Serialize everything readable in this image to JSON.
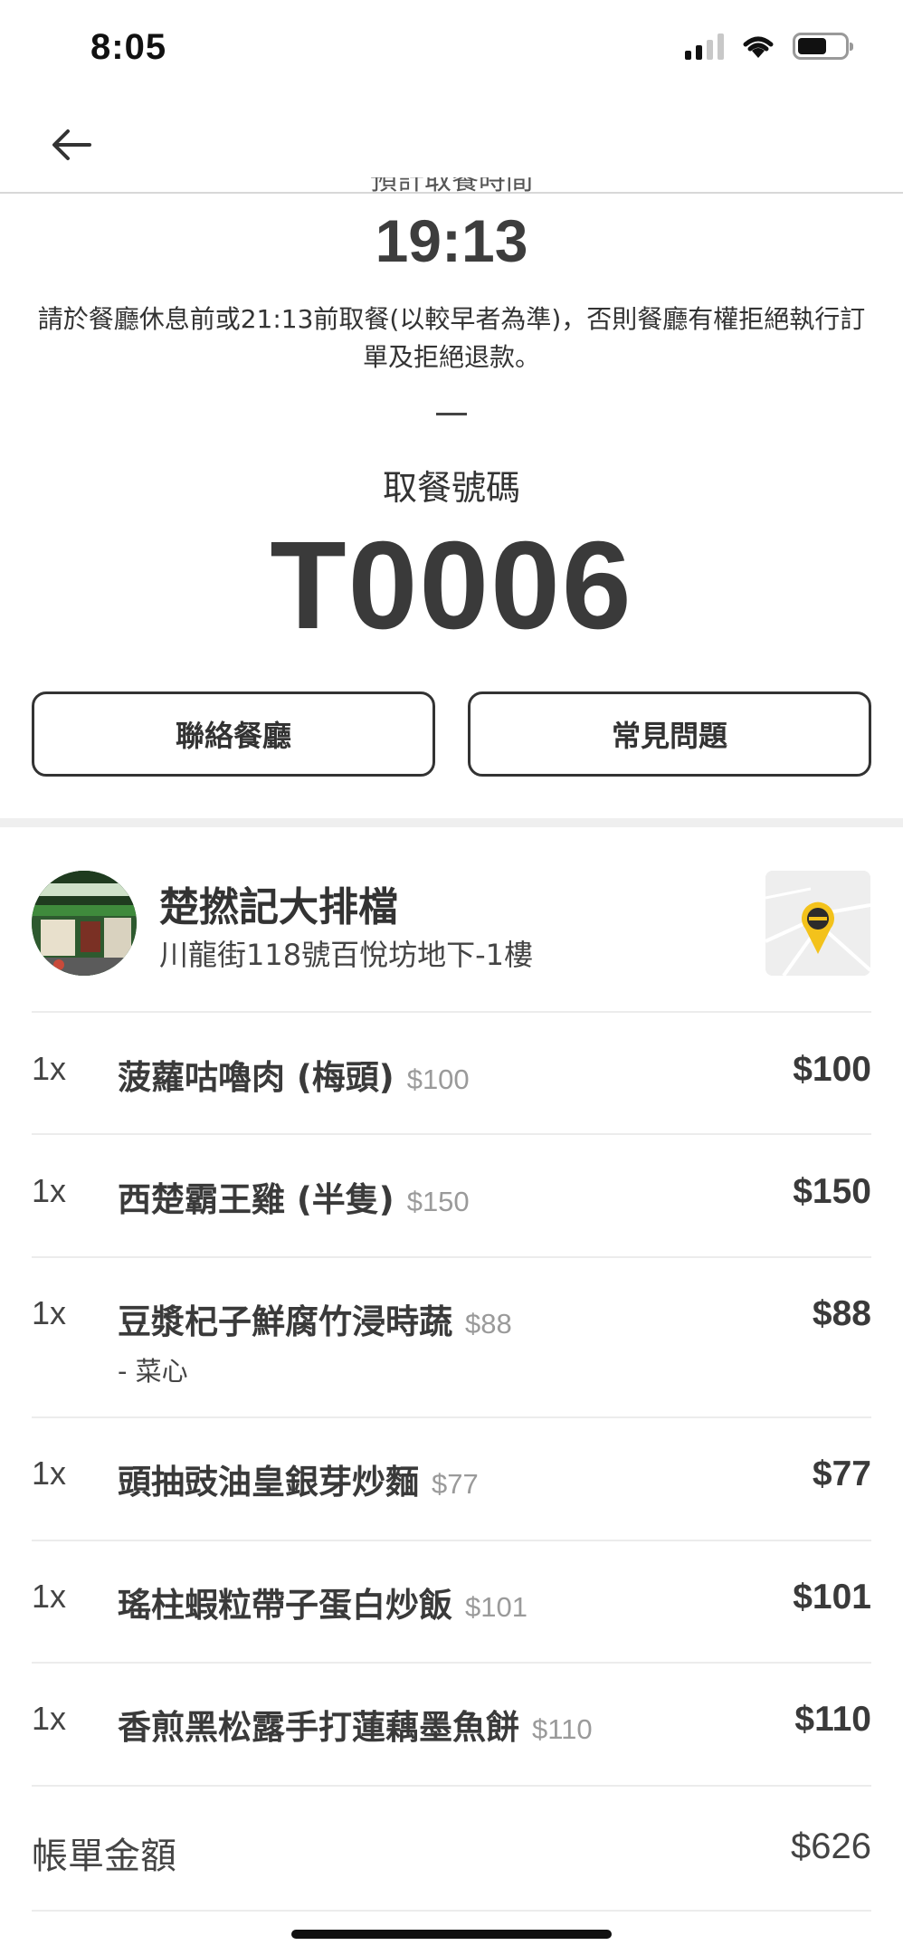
{
  "status_bar": {
    "time": "8:05"
  },
  "header": {
    "back_icon": "arrow-left-icon",
    "clipped_label": "預計取餐時間"
  },
  "pickup": {
    "time": "19:13",
    "notice": "請於餐廳休息前或21:13前取餐(以較早者為準)，否則餐廳有權拒絕執行訂單及拒絕退款。",
    "number_label": "取餐號碼",
    "number": "T0006"
  },
  "buttons": {
    "contact": "聯絡餐廳",
    "faq": "常見問題"
  },
  "restaurant": {
    "name": "楚撚記大排檔",
    "address": "川龍街118號百悅坊地下-1樓",
    "map_icon": "map-pin-icon"
  },
  "items": [
    {
      "qty": "1x",
      "name": "菠蘿咕嚕肉 (梅頭)",
      "unit_price": "$100",
      "total": "$100",
      "option": ""
    },
    {
      "qty": "1x",
      "name": "西楚霸王雞 (半隻)",
      "unit_price": "$150",
      "total": "$150",
      "option": ""
    },
    {
      "qty": "1x",
      "name": "豆漿杞子鮮腐竹浸時蔬",
      "unit_price": "$88",
      "total": "$88",
      "option": "- 菜心"
    },
    {
      "qty": "1x",
      "name": "頭抽豉油皇銀芽炒麵",
      "unit_price": "$77",
      "total": "$77",
      "option": ""
    },
    {
      "qty": "1x",
      "name": "瑤柱蝦粒帶子蛋白炒飯",
      "unit_price": "$101",
      "total": "$101",
      "option": ""
    },
    {
      "qty": "1x",
      "name": "香煎黑松露手打蓮藕墨魚餅",
      "unit_price": "$110",
      "total": "$110",
      "option": ""
    }
  ],
  "bill": {
    "label": "帳單金額",
    "amount": "$626"
  }
}
